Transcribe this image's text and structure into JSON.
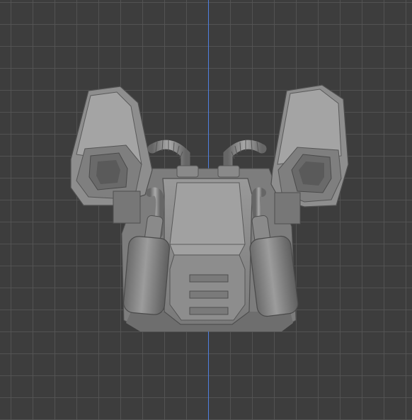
{
  "viewport": {
    "background_color": "#3d3d3d",
    "grid_color": "#565656",
    "axis_color": "#4f7fe0"
  },
  "model": {
    "name": "mech backpack",
    "shade_light": "#a6a6a6",
    "shade_mid": "#8c8c8c",
    "shade_dark": "#6a6a6a",
    "shade_edge": "#4a4a4a"
  }
}
